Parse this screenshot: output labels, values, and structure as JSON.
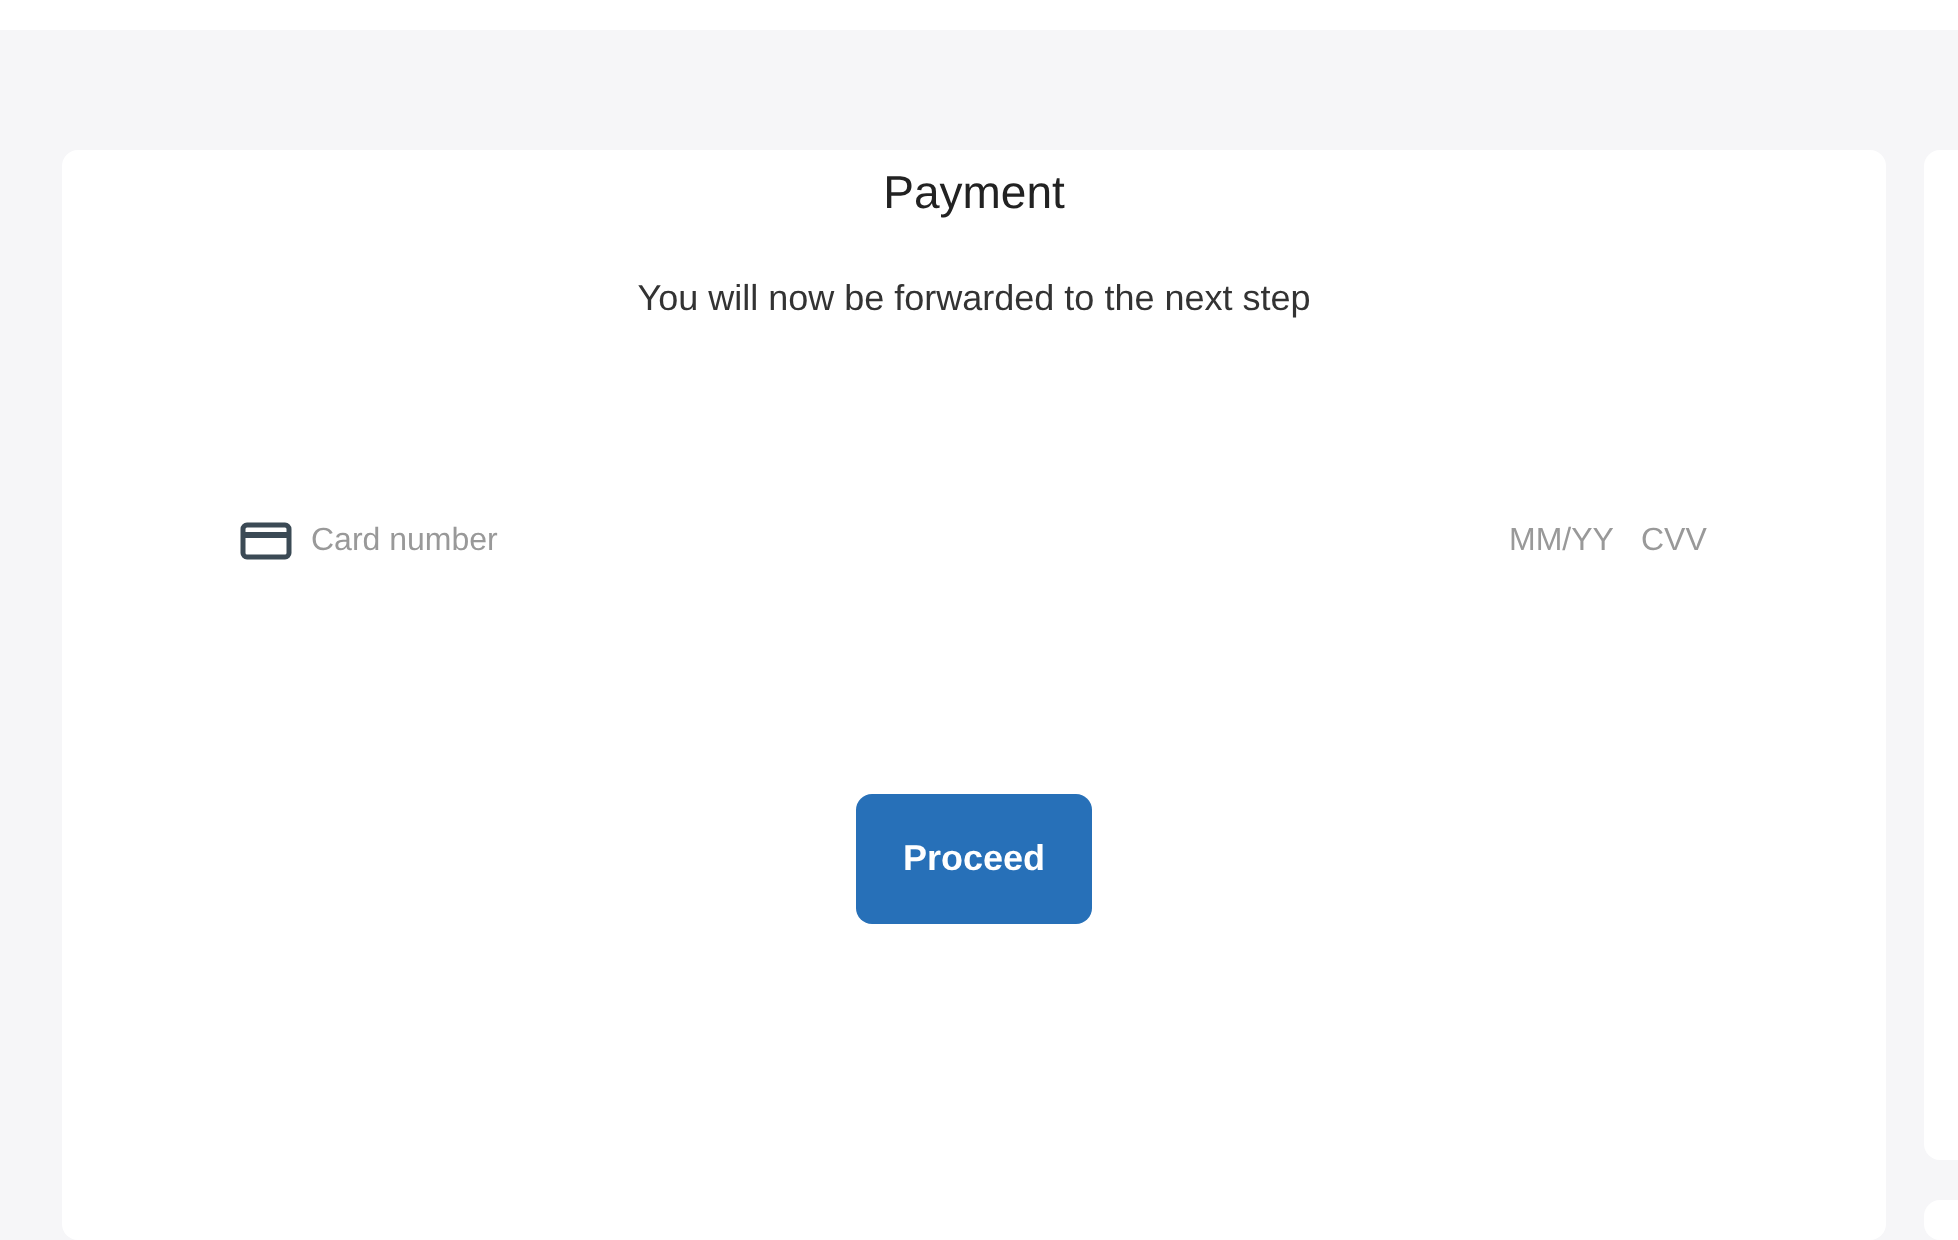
{
  "payment": {
    "title": "Payment",
    "message": "You will now be forwarded to the next step",
    "fields": [
      {
        "kind": "card",
        "placeholder": "Card number"
      },
      {
        "kind": "expiry",
        "placeholder": "MM/YY"
      },
      {
        "kind": "cvv",
        "placeholder": "CVV"
      }
    ],
    "button": "Proceed"
  }
}
